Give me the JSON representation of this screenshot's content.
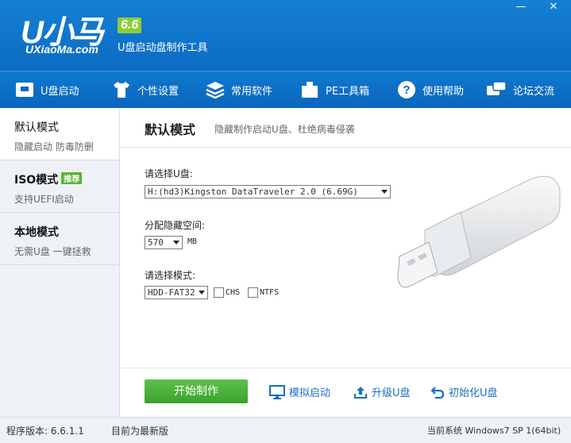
{
  "app": {
    "logo_text": "U小马",
    "version_badge": "6.6",
    "domain": "UXiaoMa.com",
    "subtitle": "U盘启动盘制作工具",
    "brand_color": "#0b6cc2"
  },
  "window_controls": {
    "minimize": "—",
    "close": "✕"
  },
  "toolbar": [
    {
      "label": "U盘启动",
      "icon": "usb-icon"
    },
    {
      "label": "个性设置",
      "icon": "shirt-icon"
    },
    {
      "label": "常用软件",
      "icon": "layers-icon"
    },
    {
      "label": "PE工具箱",
      "icon": "box-icon"
    },
    {
      "label": "使用帮助",
      "icon": "help-icon"
    },
    {
      "label": "论坛交流",
      "icon": "chat-icon"
    }
  ],
  "sidebar": {
    "items": [
      {
        "title": "默认模式",
        "subtitle": "隐藏启动 防毒防删",
        "active": true
      },
      {
        "title": "ISO模式",
        "badge": "推荐",
        "subtitle": "支持UEFI启动"
      },
      {
        "title": "本地模式",
        "subtitle": "无需U盘 一键拯救"
      }
    ]
  },
  "main": {
    "title": "默认模式",
    "description": "隐藏制作启动U盘、杜绝病毒侵袭",
    "disk_label": "请选择U盘:",
    "disk_value": "H:(hd3)Kingston DataTraveler 2.0 (6.69G)",
    "space_label": "分配隐藏空间:",
    "space_value": "570",
    "space_unit": "MB",
    "mode_label": "请选择模式:",
    "mode_value": "HDD-FAT32",
    "chs_label": "CHS",
    "ntfs_label": "NTFS",
    "chs_checked": false,
    "ntfs_checked": false
  },
  "actions": {
    "start": "开始制作",
    "simulate": "模拟启动",
    "upgrade": "升级U盘",
    "init": "初始化U盘",
    "start_color": "#3aa32b",
    "link_color": "#1a6fc4"
  },
  "status": {
    "version_label": "程序版本: 6.6.1.1",
    "update_label": "目前为最新版",
    "system_label": "当前系统 Windows7 SP 1(64bit)"
  }
}
